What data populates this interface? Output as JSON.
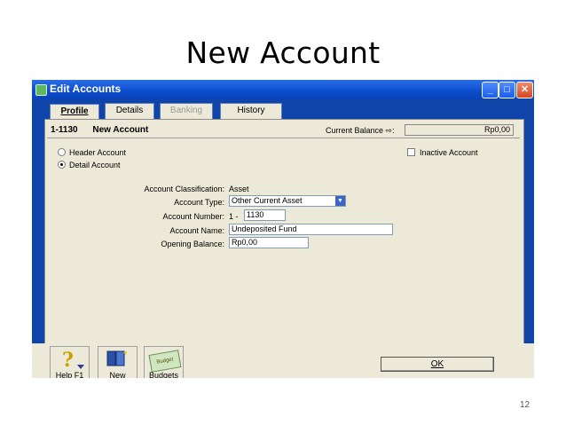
{
  "slide": {
    "title": "New Account",
    "number": "12"
  },
  "window": {
    "title": "Edit Accounts",
    "min": "_",
    "max": "□",
    "close": "✕"
  },
  "tabs": [
    {
      "label": "Profile",
      "state": "active"
    },
    {
      "label": "Details",
      "state": "normal"
    },
    {
      "label": "Banking",
      "state": "disabled"
    },
    {
      "label": "History",
      "state": "normal"
    }
  ],
  "account": {
    "number_display": "1-1130",
    "name_display": "New Account",
    "current_balance_label": "Current Balance ⇨:",
    "current_balance": "Rp0,00",
    "radio_header": "Header Account",
    "radio_detail": "Detail Account",
    "inactive_label": "Inactive Account"
  },
  "fields": {
    "classification_label": "Account Classification:",
    "classification_value": "Asset",
    "type_label": "Account Type:",
    "type_value": "Other Current Asset",
    "number_label": "Account Number:",
    "number_prefix": "1 -",
    "number_value": "1130",
    "name_label": "Account Name:",
    "name_value": "Undeposited Fund",
    "opening_label": "Opening Balance:",
    "opening_value": "Rp0,00"
  },
  "toolbar": {
    "help_label": "Help F1",
    "new_label": "New",
    "budgets_label": "Budgets",
    "budget_icon_text": "Budget",
    "ok_label": "OK"
  },
  "colors": {
    "titlebar": "#0b4bcc",
    "frame": "#0f44a8",
    "panel": "#ece9d8"
  }
}
